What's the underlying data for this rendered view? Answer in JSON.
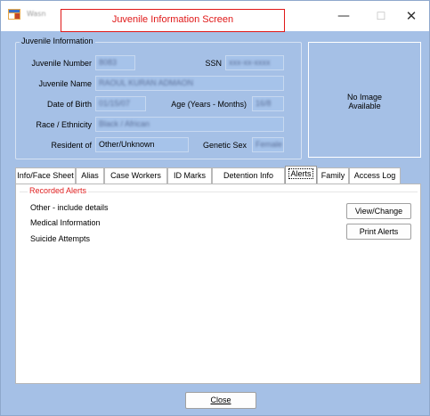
{
  "window": {
    "title": "Wasn",
    "banner": "Juvenile Information Screen",
    "minimize": "—",
    "maximize": "☐",
    "close": "✕"
  },
  "juvenile_info": {
    "group_title": "Juvenile Information",
    "labels": {
      "number": "Juvenile Number",
      "ssn": "SSN",
      "name": "Juvenile Name",
      "dob": "Date of Birth",
      "age": "Age (Years - Months)",
      "race": "Race / Ethnicity",
      "resident": "Resident of",
      "genetic_sex": "Genetic Sex"
    },
    "values": {
      "number": "8083",
      "ssn": "xxx-xx-xxxx",
      "name": "RAOUL KURAN ADMAON",
      "dob": "01/15/07",
      "age": "16/8",
      "race": "Black / African",
      "resident": "Other/Unknown",
      "genetic_sex": "Female"
    }
  },
  "photo": {
    "line1": "No Image",
    "line2": "Available"
  },
  "tabs": [
    {
      "label": "Info/Face Sheet"
    },
    {
      "label": "Alias"
    },
    {
      "label": "Case Workers"
    },
    {
      "label": "ID Marks"
    },
    {
      "label": "Detention Info"
    },
    {
      "label": "Alerts"
    },
    {
      "label": "Family"
    },
    {
      "label": "Access Log"
    }
  ],
  "alerts": {
    "group_title": "Recorded Alerts",
    "items": [
      "Other - include details",
      "Medical Information",
      "Suicide Attempts"
    ],
    "view_button": "View/Change",
    "print_button": "Print Alerts"
  },
  "footer": {
    "close_label": "Close"
  }
}
